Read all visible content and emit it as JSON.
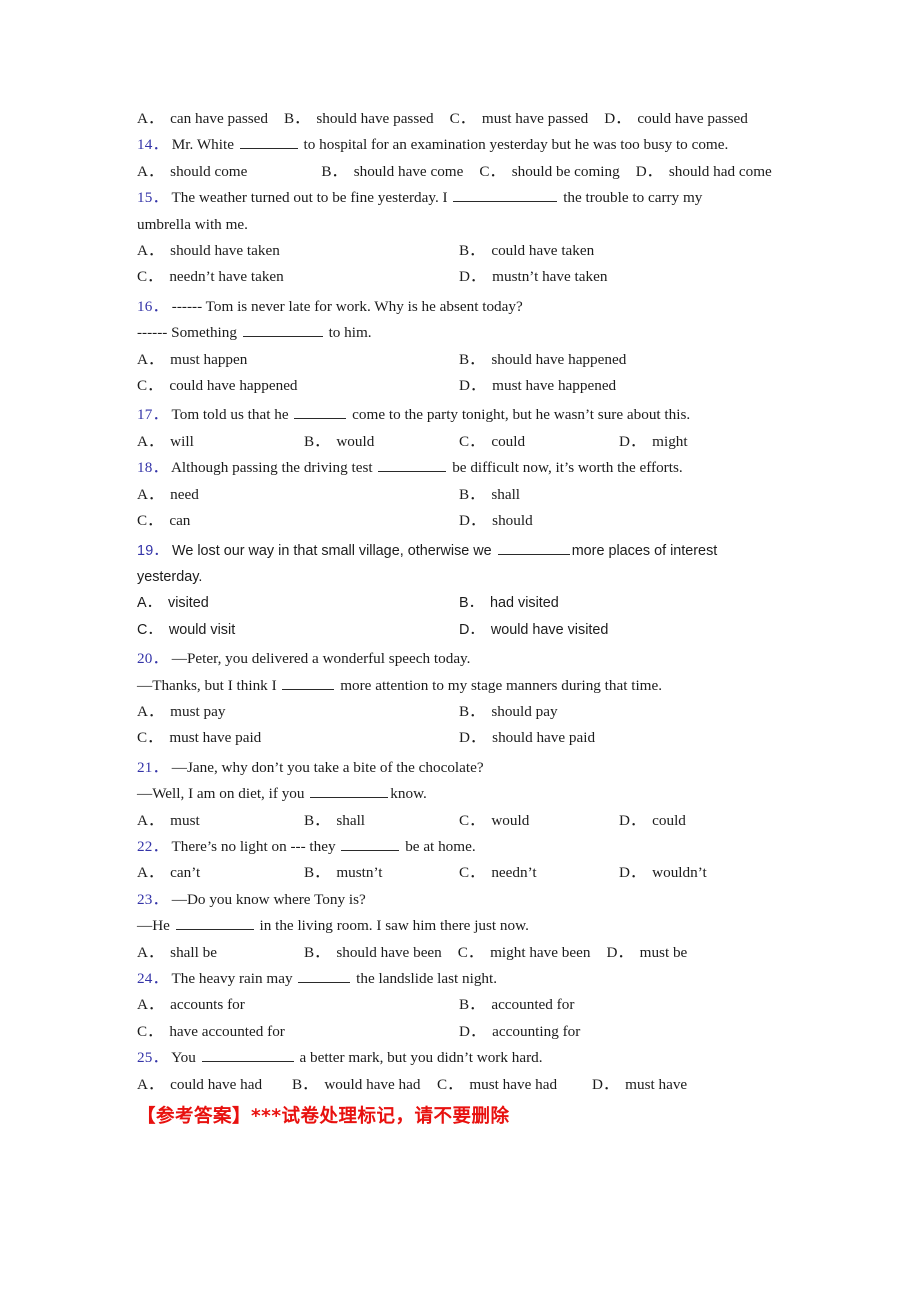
{
  "document": {
    "type": "english-grammar-worksheet",
    "colors": {
      "question_number": "#3434a8",
      "body_text": "#1c1c1c",
      "answer_marker": "#e8110f",
      "page_background": "#ffffff"
    }
  },
  "questions": [
    {
      "id": "q13-options",
      "number": "",
      "stem": "",
      "layout": "tight",
      "options": [
        {
          "label": "A",
          "text": "can have passed"
        },
        {
          "label": "B",
          "text": "should have passed"
        },
        {
          "label": "C",
          "text": "must have passed"
        },
        {
          "label": "D",
          "text": "could have passed"
        }
      ]
    },
    {
      "id": "q14",
      "number": "14",
      "stem_before": "Mr. White",
      "stem_after": "to hospital for an examination yesterday but he was too busy to come.",
      "layout": "tight",
      "options": [
        {
          "label": "A",
          "text": "should come"
        },
        {
          "label": "B",
          "text": "should have come"
        },
        {
          "label": "C",
          "text": "should be coming"
        },
        {
          "label": "D",
          "text": "should had come"
        }
      ]
    },
    {
      "id": "q15",
      "number": "15",
      "stem_before": "The weather turned out to be fine yesterday. I",
      "stem_after": "the trouble to carry my umbrella with me.",
      "layout": "two",
      "options": [
        {
          "label": "A",
          "text": "should have taken"
        },
        {
          "label": "B",
          "text": "could have taken"
        },
        {
          "label": "C",
          "text": "needn’t have taken"
        },
        {
          "label": "D",
          "text": "mustn’t have taken"
        }
      ]
    },
    {
      "id": "q16",
      "number": "16",
      "stem_line1": "------ Tom is never late for work. Why is he absent today?",
      "stem_line2_before": "------ Something",
      "stem_line2_after": "to him.",
      "layout": "two",
      "options": [
        {
          "label": "A",
          "text": "must happen"
        },
        {
          "label": "B",
          "text": "should have happened"
        },
        {
          "label": "C",
          "text": "could have happened"
        },
        {
          "label": "D",
          "text": "must have happened"
        }
      ]
    },
    {
      "id": "q17",
      "number": "17",
      "stem_before": "Tom told us that he",
      "stem_after": "come to the party tonight, but he wasn’t sure about this.",
      "layout": "four",
      "options": [
        {
          "label": "A",
          "text": "will"
        },
        {
          "label": "B",
          "text": "would"
        },
        {
          "label": "C",
          "text": "could"
        },
        {
          "label": "D",
          "text": "might"
        }
      ]
    },
    {
      "id": "q18",
      "number": "18",
      "stem_before": "Although passing the driving test",
      "stem_after": "be difficult now, it’s worth the efforts.",
      "layout": "two",
      "options": [
        {
          "label": "A",
          "text": "need"
        },
        {
          "label": "B",
          "text": "shall"
        },
        {
          "label": "C",
          "text": "can"
        },
        {
          "label": "D",
          "text": "should"
        }
      ]
    },
    {
      "id": "q19",
      "number": "19",
      "stem_before": "We lost our way in that small village, otherwise we",
      "stem_after": "more places of interest yesterday.",
      "layout": "two",
      "font": "sans",
      "options": [
        {
          "label": "A",
          "text": "visited"
        },
        {
          "label": "B",
          "text": "had visited"
        },
        {
          "label": "C",
          "text": "would visit"
        },
        {
          "label": "D",
          "text": "would have visited"
        }
      ]
    },
    {
      "id": "q20",
      "number": "20",
      "stem_line1": "—Peter, you delivered a wonderful speech today.",
      "stem_line2_before": "—Thanks, but I think I",
      "stem_line2_after": "more attention to my stage manners during that time.",
      "layout": "two",
      "options": [
        {
          "label": "A",
          "text": "must pay"
        },
        {
          "label": "B",
          "text": "should pay"
        },
        {
          "label": "C",
          "text": "must have paid"
        },
        {
          "label": "D",
          "text": "should have paid"
        }
      ]
    },
    {
      "id": "q21",
      "number": "21",
      "stem_line1": "—Jane, why don’t you take a bite of the chocolate?",
      "stem_line2_before": "—Well, I am on diet, if you",
      "stem_line2_after": "know.",
      "layout": "four",
      "options": [
        {
          "label": "A",
          "text": "must"
        },
        {
          "label": "B",
          "text": "shall"
        },
        {
          "label": "C",
          "text": "would"
        },
        {
          "label": "D",
          "text": "could"
        }
      ]
    },
    {
      "id": "q22",
      "number": "22",
      "stem_before": "There’s no light on --- they",
      "stem_after": "be at home.",
      "layout": "four",
      "options": [
        {
          "label": "A",
          "text": "can’t"
        },
        {
          "label": "B",
          "text": "mustn’t"
        },
        {
          "label": "C",
          "text": "needn’t"
        },
        {
          "label": "D",
          "text": "wouldn’t"
        }
      ]
    },
    {
      "id": "q23",
      "number": "23",
      "stem_line1": "—Do you know where Tony is?",
      "stem_line2_before": "—He",
      "stem_line2_after": "in the living room. I saw him there just now.",
      "layout": "tight",
      "options": [
        {
          "label": "A",
          "text": "shall be"
        },
        {
          "label": "B",
          "text": "should have been"
        },
        {
          "label": "C",
          "text": "might have been"
        },
        {
          "label": "D",
          "text": "must be"
        }
      ]
    },
    {
      "id": "q24",
      "number": "24",
      "stem_before": "The heavy rain may",
      "stem_after": "the landslide last night.",
      "layout": "two",
      "options": [
        {
          "label": "A",
          "text": "accounts for"
        },
        {
          "label": "B",
          "text": "accounted for"
        },
        {
          "label": "C",
          "text": "have accounted for"
        },
        {
          "label": "D",
          "text": "accounting for"
        }
      ]
    },
    {
      "id": "q25",
      "number": "25",
      "stem_before": "You",
      "stem_after": "a better mark, but you didn’t work hard.",
      "layout": "tight",
      "options": [
        {
          "label": "A",
          "text": "could have had"
        },
        {
          "label": "B",
          "text": "would have had"
        },
        {
          "label": "C",
          "text": "must have had"
        },
        {
          "label": "D",
          "text": "must have"
        }
      ]
    }
  ],
  "answer_marker": {
    "text": "【参考答案】***试卷处理标记，请不要删除"
  }
}
